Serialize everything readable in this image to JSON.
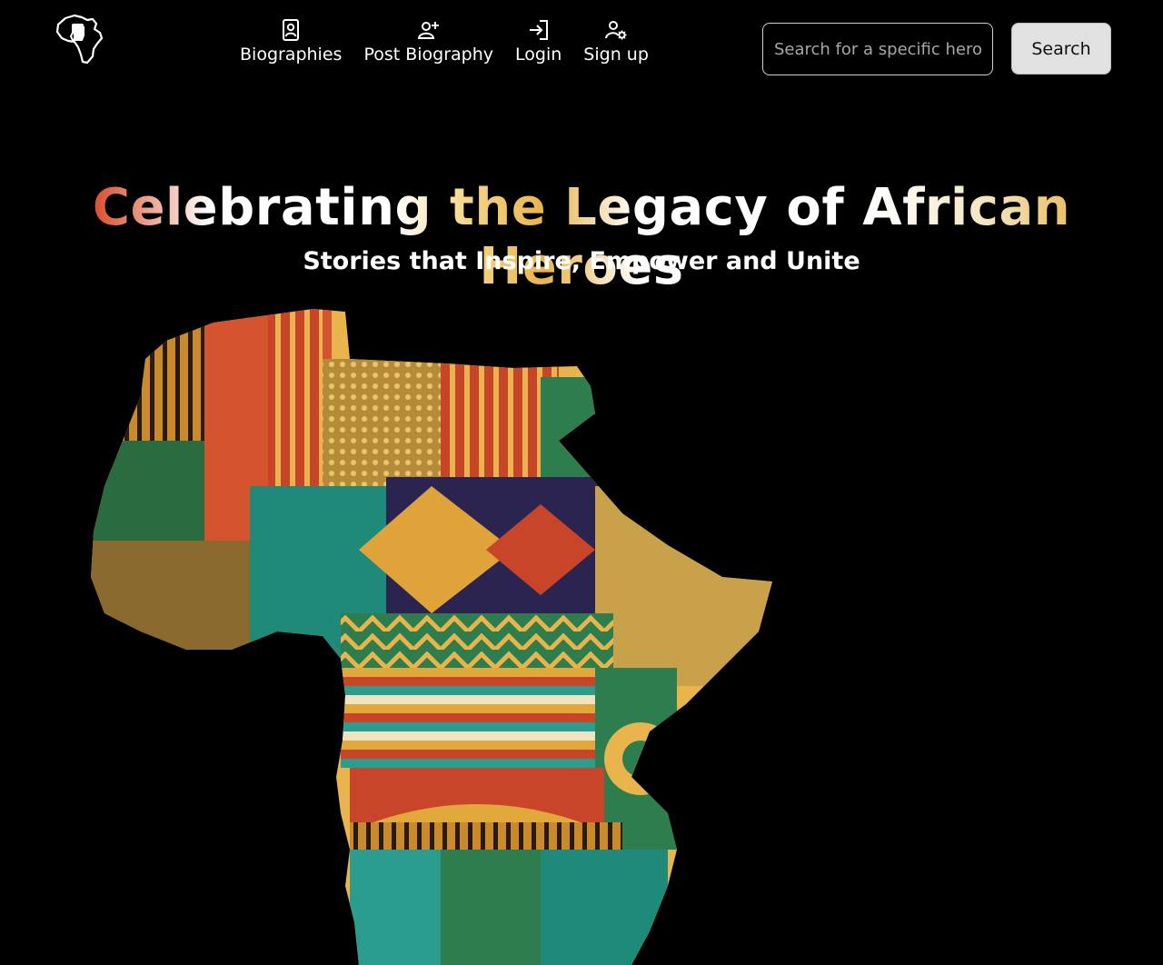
{
  "navbar": {
    "logo_icon": "africa-fist-icon",
    "links": [
      {
        "label": "Biographies",
        "icon": "portrait-icon"
      },
      {
        "label": "Post Biography",
        "icon": "user-plus-icon"
      },
      {
        "label": "Login",
        "icon": "login-icon"
      },
      {
        "label": "Sign up",
        "icon": "user-gear-icon"
      }
    ],
    "search": {
      "placeholder": "Search for a specific hero.",
      "value": "",
      "button_label": "Search"
    }
  },
  "hero": {
    "title": "Celebrating the Legacy of African Heroes",
    "subtitle": "Stories that Inspire, Empower and Unite",
    "image": "patterned-africa-map"
  },
  "colors": {
    "background": "#000000",
    "text": "#ffffff",
    "button_bg": "#e1e1e1",
    "accent_gold": "#e9b44c",
    "accent_red": "#d94e2a",
    "accent_green": "#2e7d4f",
    "accent_teal": "#2a9d8f"
  }
}
